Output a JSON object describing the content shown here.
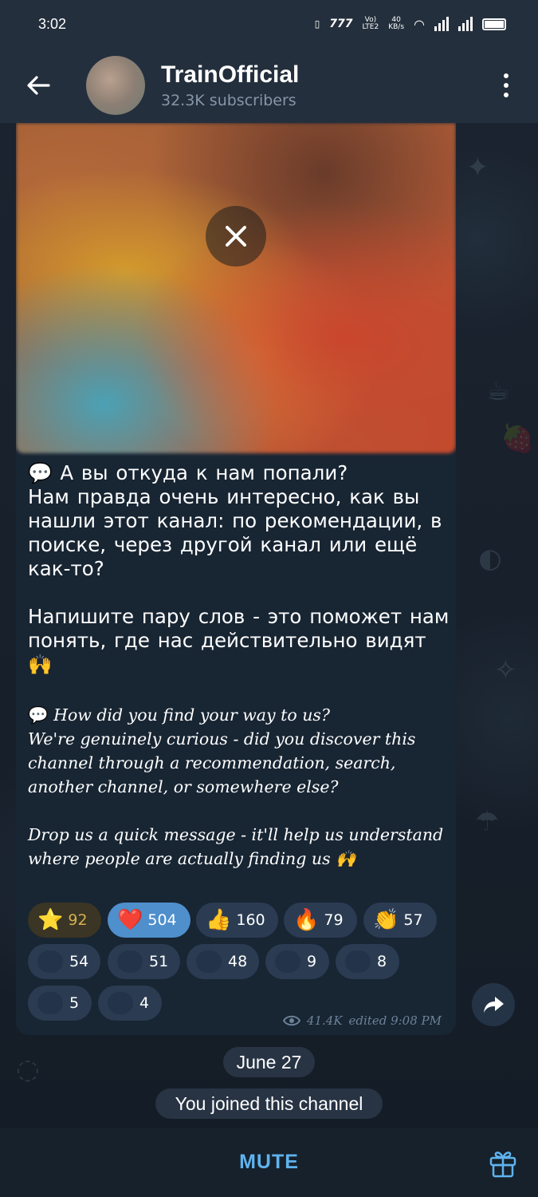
{
  "status_bar": {
    "time": "3:02",
    "volte": "Vo)\nLTE2",
    "speed": "40\nKB/s"
  },
  "header": {
    "title": "TrainOfficial",
    "subtitle": "32.3K subscribers"
  },
  "message": {
    "ru_paragraphs": [
      "А вы откуда к нам попали?",
      "Нам правда очень интересно, как вы нашли этот канал: по рекомендации, в поиске, через другой канал или ещё как-то?",
      "Напишите пару слов - это поможет нам понять, где нас действительно видят 🙌"
    ],
    "en_paragraphs": [
      "How did you find your way to us?",
      "We're genuinely curious - did you discover this channel through a recommendation, search, another channel, or somewhere else?",
      "Drop us a quick message - it'll help us understand where people are actually finding us 🙌"
    ],
    "reactions": [
      {
        "emoji": "⭐",
        "count": "92",
        "style": "star"
      },
      {
        "emoji": "❤️",
        "count": "504",
        "style": "active"
      },
      {
        "emoji": "👍",
        "count": "160",
        "style": "normal"
      },
      {
        "emoji": "🔥",
        "count": "79",
        "style": "normal"
      },
      {
        "emoji": "👏",
        "count": "57",
        "style": "normal"
      },
      {
        "emoji": "",
        "count": "54",
        "style": "normal"
      },
      {
        "emoji": "",
        "count": "51",
        "style": "normal"
      },
      {
        "emoji": "",
        "count": "48",
        "style": "normal"
      },
      {
        "emoji": "",
        "count": "9",
        "style": "normal"
      },
      {
        "emoji": "",
        "count": "8",
        "style": "normal"
      },
      {
        "emoji": "",
        "count": "5",
        "style": "normal"
      },
      {
        "emoji": "",
        "count": "4",
        "style": "normal"
      }
    ],
    "views": "41.4K",
    "edited_time": "edited 9:08 PM"
  },
  "date_chip": "June 27",
  "service_message": "You joined this channel",
  "bottom_bar": {
    "mute_label": "MUTE"
  },
  "colors": {
    "header_bg": "#242f3d",
    "bubble_bg": "#182533",
    "accent": "#5fb3ef",
    "active_reaction": "#4e8fcc"
  }
}
